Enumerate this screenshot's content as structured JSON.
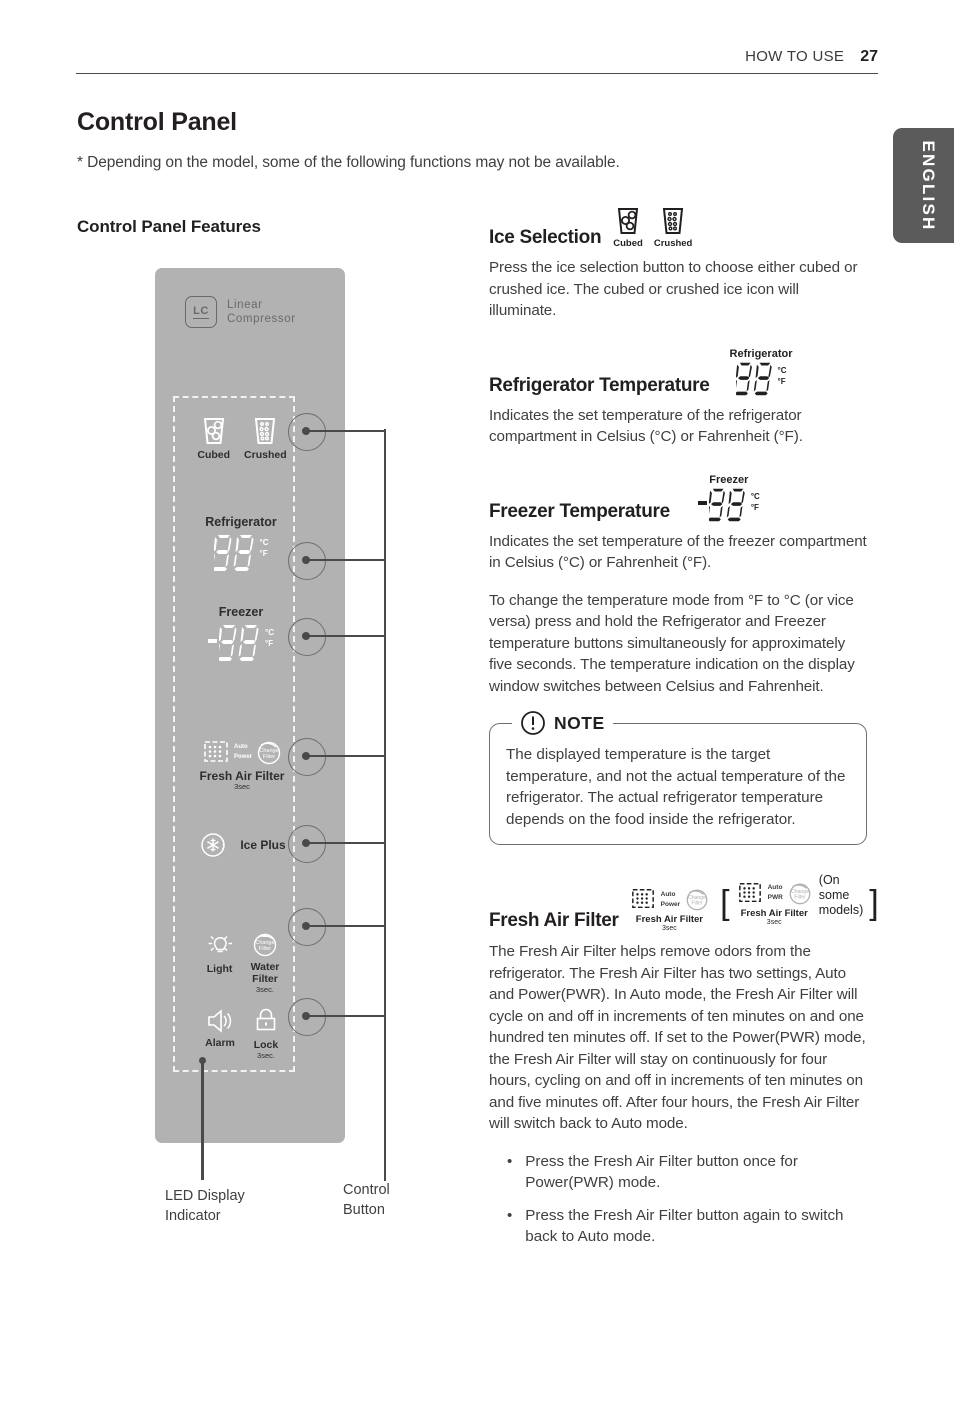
{
  "header": {
    "section": "HOW TO USE",
    "page_number": "27",
    "language_tab": "ENGLISH"
  },
  "title": "Control Panel",
  "model_note": "* Depending on the model, some of the following functions may not be available.",
  "left": {
    "heading": "Control Panel Features",
    "brand": {
      "badge": "LC",
      "label_line1": "Linear",
      "label_line2": "Compressor"
    },
    "ice": {
      "cubed": "Cubed",
      "crushed": "Crushed"
    },
    "refrigerator": {
      "label": "Refrigerator",
      "digits": "88",
      "unit_c": "°C",
      "unit_f": "°F"
    },
    "freezer": {
      "label": "Freezer",
      "digits": "88",
      "unit_c": "°C",
      "unit_f": "°F",
      "sign": "-"
    },
    "fresh_air_filter": {
      "label": "Fresh Air Filter",
      "hold": "3sec",
      "mode_auto": "Auto",
      "mode_power": "Power",
      "change_line1": "Change",
      "change_line2": "Filter"
    },
    "ice_plus": {
      "label": "Ice Plus"
    },
    "light": {
      "label": "Light"
    },
    "water_filter": {
      "label_line1": "Water",
      "label_line2": "Filter",
      "hold": "3sec.",
      "change_line1": "Change",
      "change_line2": "Filter"
    },
    "alarm": {
      "label": "Alarm"
    },
    "lock": {
      "label": "Lock",
      "hold": "3sec."
    },
    "caption_led_line1": "LED Display",
    "caption_led_line2": "Indicator",
    "caption_btn_line1": "Control",
    "caption_btn_line2": "Button"
  },
  "right": {
    "ice_selection": {
      "title": "Ice Selection",
      "icon_cubed": "Cubed",
      "icon_crushed": "Crushed",
      "body": "Press the ice selection button to choose either cubed or crushed ice. The cubed or crushed ice icon will illuminate."
    },
    "refrigerator_temperature": {
      "title": "Refrigerator Temperature",
      "display_label": "Refrigerator",
      "digits": "88",
      "unit_c": "°C",
      "unit_f": "°F",
      "body": "Indicates the set temperature of the refrigerator compartment in Celsius (°C) or Fahrenheit (°F)."
    },
    "freezer_temperature": {
      "title": "Freezer Temperature",
      "display_label": "Freezer",
      "sign": "-",
      "digits": "88",
      "unit_c": "°C",
      "unit_f": "°F",
      "body": "Indicates the set temperature of the freezer compartment in Celsius (°C) or Fahrenheit (°F).",
      "body2": "To change the temperature mode from °F to °C (or vice versa) press and hold the Refrigerator and Freezer temperature buttons simultaneously for approximately five seconds. The temperature indication on the display window switches between Celsius and Fahrenheit."
    },
    "note": {
      "title": "NOTE",
      "body": "The displayed temperature is the target temperature, and not the actual temperature of the refrigerator. The actual refrigerator temperature depends on the food inside the refrigerator."
    },
    "fresh_air_filter": {
      "title": "Fresh Air Filter",
      "icon1": {
        "mode_a": "Auto",
        "mode_b": "Power",
        "change_line1": "Change",
        "change_line2": "Filter",
        "name": "Fresh Air Filter",
        "hold": "3sec"
      },
      "icon2": {
        "mode_a": "Auto",
        "mode_b": "PWR",
        "change_line1": "Change",
        "change_line2": "Filter",
        "name": "Fresh Air Filter",
        "hold": "3sec"
      },
      "bracket_open": "[",
      "bracket_close": "]",
      "on_some_models_line1": "(On some",
      "on_some_models_line2": "models)",
      "body": "The Fresh Air Filter helps remove odors from the refrigerator. The Fresh Air Filter has two settings, Auto and Power(PWR). In Auto mode, the Fresh Air Filter will cycle on and off in increments of ten minutes on and one hundred ten minutes off. If set to the Power(PWR) mode, the Fresh Air Filter will stay on continuously for four hours, cycling on and off in increments of ten minutes on and five minutes off. After four hours, the Fresh Air Filter will switch back to Auto mode.",
      "bullets": [
        "Press the Fresh Air Filter button once for Power(PWR) mode.",
        "Press the Fresh Air Filter button again to switch back to Auto mode."
      ],
      "bullet_glyph": "•"
    }
  },
  "colors": {
    "panel_gray": "#b2b2b2",
    "tab_gray": "#5b5b5b",
    "text": "#231f20",
    "body_text": "#3f3f3f"
  }
}
